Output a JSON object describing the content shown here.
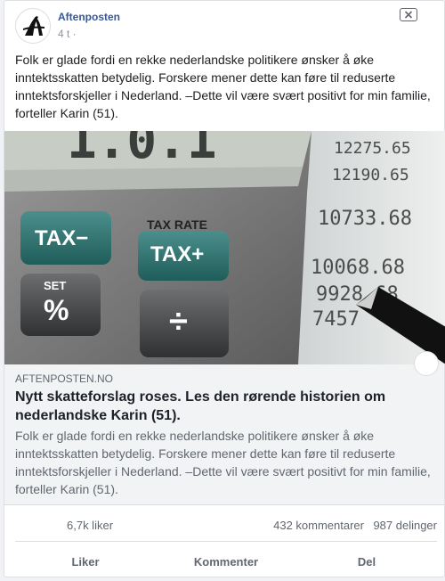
{
  "post": {
    "page_name": "Aftenposten",
    "time": "4 t ·",
    "text": "Folk er glade fordi en rekke nederlandske politikere ønsker å øke inntektsskatten betydelig. Forskere mener dette kan føre til reduserte inntektsforskjeller i Nederland. –Dette vil være svært positivt for min familie, forteller Karin (51).",
    "avatar_glyph": "A",
    "close_icon": "close-icon"
  },
  "image": {
    "calculator_keys": [
      "TAX−",
      "TAX RATE",
      "TAX+",
      "SET",
      "%",
      "÷"
    ],
    "paper_numbers": [
      "12275.65",
      "12190.65",
      "10733.68",
      "10068.68",
      "9928.68",
      "7457"
    ]
  },
  "link": {
    "domain": "AFTENPOSTEN.NO",
    "title": "Nytt skatteforslag roses. Les den rørende historien om nederlandske Karin (51).",
    "description": "Folk er glade fordi en rekke nederlandske politikere ønsker å øke inntektsskatten betydelig. Forskere mener dette kan føre til reduserte inntektsforskjeller i Nederland. –Dette vil være svært positivt for min familie, forteller Karin (51)."
  },
  "counts": {
    "likes": "6,7k liker",
    "comments": "432 kommentarer",
    "shares": "987 delinger"
  },
  "actions": {
    "like": "Liker",
    "comment": "Kommenter",
    "share": "Del"
  },
  "colors": {
    "link_blue": "#385898",
    "meta_gray": "#606770",
    "preview_bg": "#f2f3f5"
  }
}
